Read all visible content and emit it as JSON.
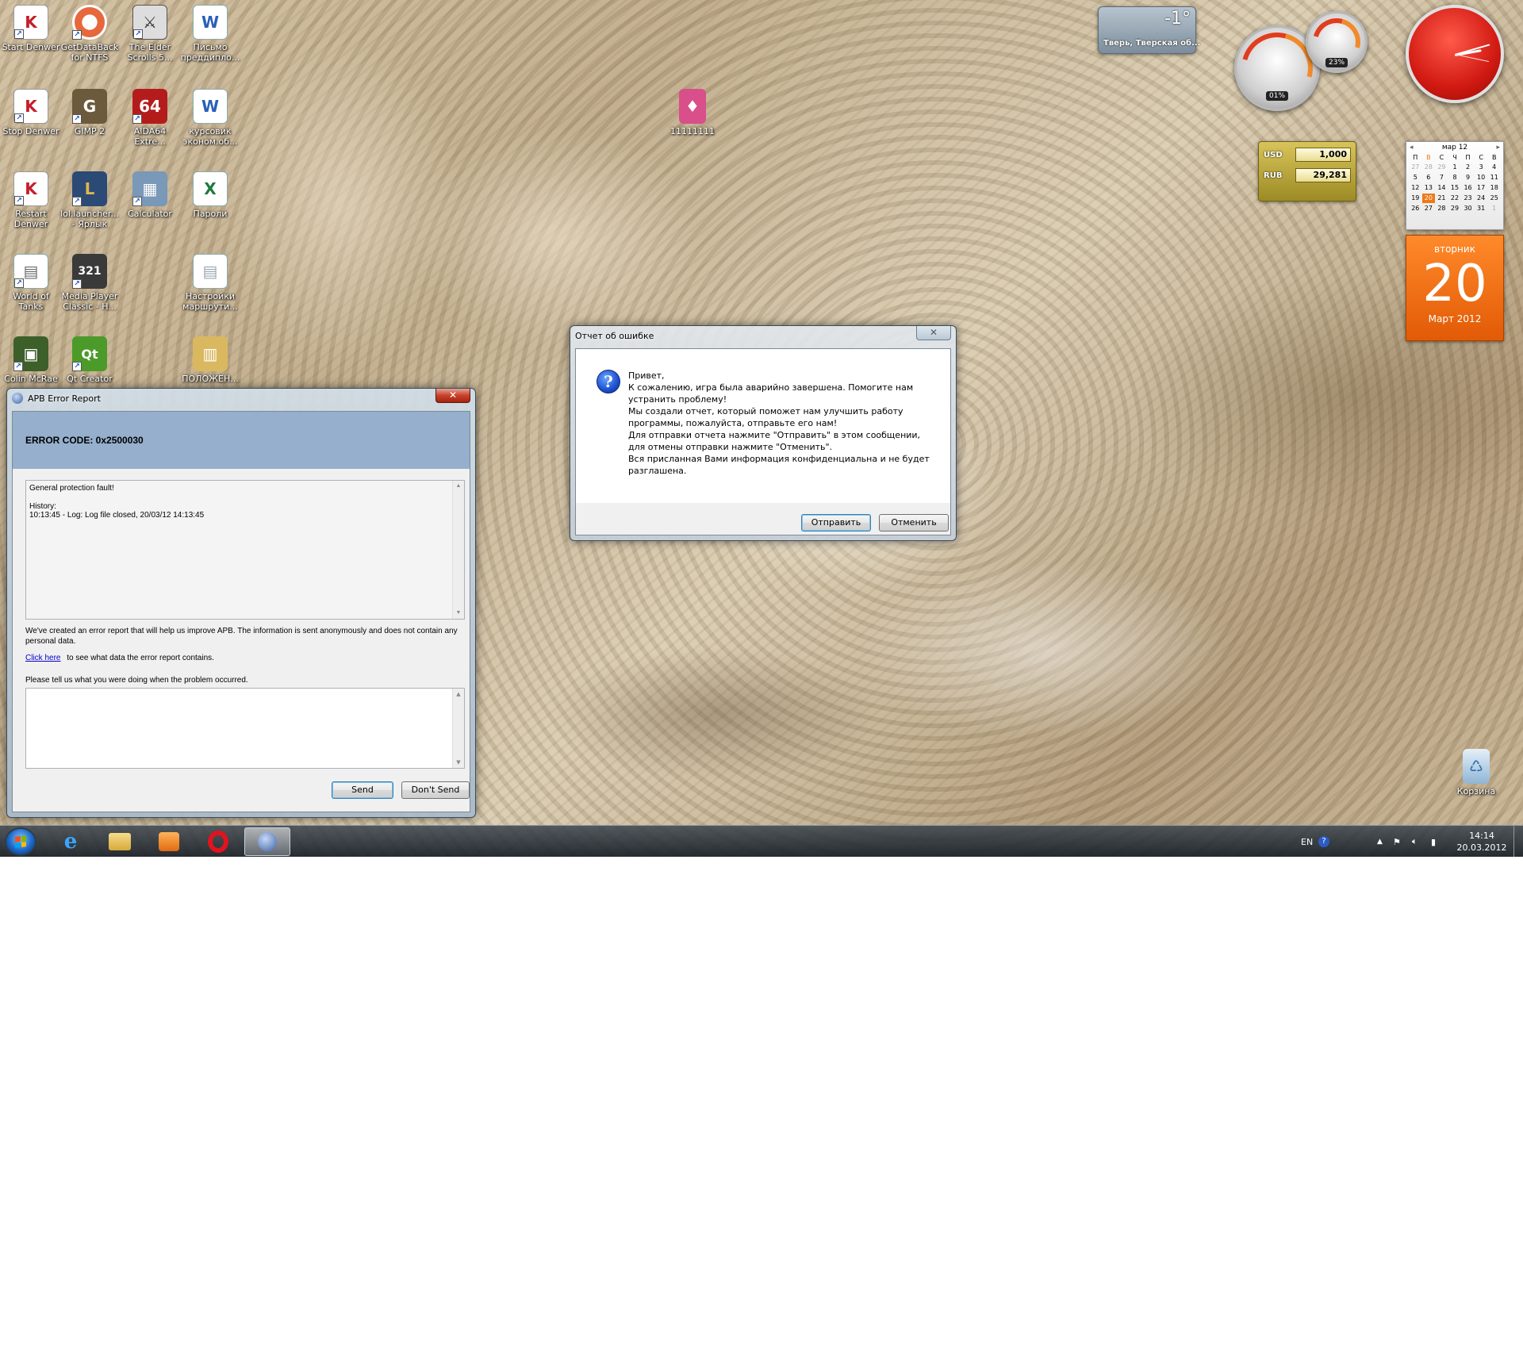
{
  "desktop": {
    "icons": [
      {
        "label": "Start Denwer",
        "glyph": "K",
        "color": "#c41e2a"
      },
      {
        "label": "GetDataBack for NTFS",
        "glyph": "◎",
        "color": "#e6683c"
      },
      {
        "label": "The Elder Scrolls 5...",
        "glyph": "⚔",
        "color": "#5b5b5b"
      },
      {
        "label": "Письмо преддипло...",
        "glyph": "W",
        "color": "#2b5fb8"
      },
      {
        "label": "Stop Denwer",
        "glyph": "K",
        "color": "#c41e2a"
      },
      {
        "label": "GIMP 2",
        "glyph": "G",
        "color": "#6b5a3c"
      },
      {
        "label": "AIDA64 Extre...",
        "glyph": "64",
        "color": "#b41c1c"
      },
      {
        "label": "курсовик эконом.об...",
        "glyph": "W",
        "color": "#2b5fb8"
      },
      {
        "label": "Restart Denwer",
        "glyph": "K",
        "color": "#c41e2a"
      },
      {
        "label": "lol.launcher... - Ярлык",
        "glyph": "L",
        "color": "#2b4a76"
      },
      {
        "label": "Calculator",
        "glyph": "▦",
        "color": "#7a98b8"
      },
      {
        "label": "Пароли",
        "glyph": "X",
        "color": "#1e7a3c"
      },
      {
        "label": "World of Tanks",
        "glyph": "▤",
        "color": "#6a6a6a"
      },
      {
        "label": "Media Player Classic - H...",
        "glyph": "321",
        "color": "#3a3a3a"
      },
      {
        "label": "Настройки маршрути...",
        "glyph": "▤",
        "color": "#9aa6b0"
      },
      {
        "label": "Colin McRae",
        "glyph": "▣",
        "color": "#3d5f2a"
      },
      {
        "label": "Qt Creator",
        "glyph": "Qt",
        "color": "#4c9a2a"
      },
      {
        "label": "ПОЛОЖЕН...",
        "glyph": "▥",
        "color": "#d9b860"
      },
      {
        "label": "11111111",
        "glyph": "♦",
        "color": "#d84f8a"
      },
      {
        "label": "Корзина",
        "glyph": "♺",
        "color": "#8fb5d6"
      }
    ],
    "gadgets": {
      "weather": {
        "temp": "-1°",
        "city": "Тверь, Тверская об..."
      },
      "cpu_gauge": {
        "reading": "01%"
      },
      "mem_gauge": {
        "reading": "23%"
      },
      "currency": [
        {
          "code": "USD",
          "value": "1,000"
        },
        {
          "code": "RUB",
          "value": "29,281"
        }
      ],
      "calendar": {
        "month_header": "мар 12",
        "weekdays": [
          "П",
          "В",
          "С",
          "Ч",
          "П",
          "С",
          "В"
        ],
        "days": [
          "27",
          "28",
          "29",
          "1",
          "2",
          "3",
          "4",
          "5",
          "6",
          "7",
          "8",
          "9",
          "10",
          "11",
          "12",
          "13",
          "14",
          "15",
          "16",
          "17",
          "18",
          "19",
          "20",
          "21",
          "22",
          "23",
          "24",
          "25",
          "26",
          "27",
          "28",
          "29",
          "30",
          "31",
          "1"
        ],
        "weekday_name": "вторник",
        "day_number": "20",
        "month_year": "Март 2012"
      }
    }
  },
  "apb_window": {
    "title": "APB Error Report",
    "error_code": "ERROR CODE: 0x2500030",
    "log_line1": "General protection fault!",
    "log_line2": "History:",
    "log_line3": "10:13:45 - Log: Log file closed, 20/03/12 14:13:45",
    "info_text": "We've created an error report that will help us improve APB. The information is sent anonymously and does not contain any personal data.",
    "link_text": "Click here",
    "link_suffix": "to see what data the error report contains.",
    "prompt_text": "Please tell us what you were doing when the problem occurred.",
    "send_label": "Send",
    "dont_send_label": "Don't Send"
  },
  "ru_dialog": {
    "title": "Отчет об ошибке",
    "message_lines": [
      "Привет,",
      "К сожалению, игра была аварийно завершена. Помогите нам устранить проблему!",
      "Мы создали отчет, который поможет нам улучшить работу программы, пожалуйста, отправьте его нам!",
      "Для отправки отчета нажмите \"Отправить\" в этом сообщении, для отмены отправки нажмите \"Отменить\".",
      "Вся присланная Вами информация конфиденциальна и не будет разглашена."
    ],
    "send_label": "Отправить",
    "cancel_label": "Отменить"
  },
  "taskbar": {
    "language": "EN",
    "time": "14:14",
    "date": "20.03.2012"
  }
}
